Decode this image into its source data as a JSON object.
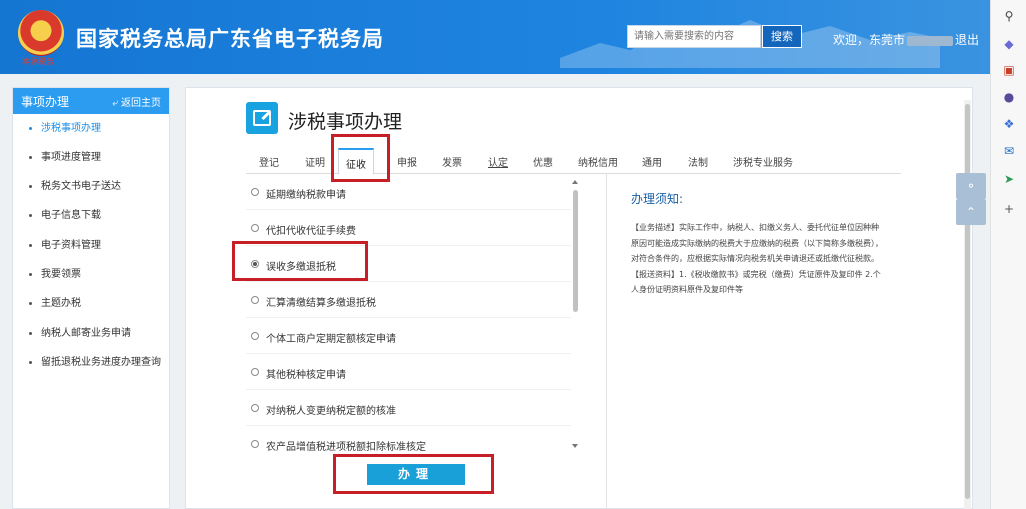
{
  "header": {
    "emblem_text": "本源税务",
    "title": "国家税务总局广东省电子税务局",
    "search_placeholder": "请输入需要搜索的内容",
    "search_button": "搜索",
    "welcome_prefix": "欢迎，东莞市",
    "welcome_suffix": "退出"
  },
  "sidebar": {
    "title": "事项办理",
    "back": "返回主页",
    "items": [
      {
        "label": "涉税事项办理"
      },
      {
        "label": "事项进度管理"
      },
      {
        "label": "税务文书电子送达"
      },
      {
        "label": "电子信息下载"
      },
      {
        "label": "电子资料管理"
      },
      {
        "label": "我要领票"
      },
      {
        "label": "主题办税"
      },
      {
        "label": "纳税人邮寄业务申请"
      },
      {
        "label": "留抵退税业务进度办理查询"
      }
    ]
  },
  "main": {
    "title": "涉税事项办理",
    "tabs": [
      {
        "label": "登记"
      },
      {
        "label": "证明"
      },
      {
        "label": "征收"
      },
      {
        "label": "申报"
      },
      {
        "label": "发票"
      },
      {
        "label": "认定"
      },
      {
        "label": "优惠"
      },
      {
        "label": "纳税信用"
      },
      {
        "label": "通用"
      },
      {
        "label": "法制"
      },
      {
        "label": "涉税专业服务"
      }
    ],
    "items": [
      {
        "label": "延期缴纳税款申请",
        "selected": false
      },
      {
        "label": "代扣代收代征手续费",
        "selected": false
      },
      {
        "label": "误收多缴退抵税",
        "selected": true
      },
      {
        "label": "汇算清缴结算多缴退抵税",
        "selected": false
      },
      {
        "label": "个体工商户定期定额核定申请",
        "selected": false
      },
      {
        "label": "其他税种核定申请",
        "selected": false
      },
      {
        "label": "对纳税人变更纳税定额的核准",
        "selected": false
      },
      {
        "label": "农产品增值税进项税额扣除标准核定",
        "selected": false
      }
    ],
    "info_title": "办理须知:",
    "info_text": "【业务描述】实际工作中，纳税人、扣缴义务人、委托代征单位因种种原因可能造成实际缴纳的税费大于应缴纳的税费（以下简称多缴税费），对符合条件的，应根据实际情况向税务机关申请退还或抵缴代征税款。【报送资料】1.《税收缴款书》或完税（缴费）凭证原件及复印件 2.个人身份证明资料原件及复印件等",
    "submit": "办理"
  },
  "colors": {
    "header_blue": "#1576d2",
    "sidebar_blue": "#2c9cf0",
    "highlight_red": "#c62026",
    "button_blue": "#1aa0d8"
  }
}
